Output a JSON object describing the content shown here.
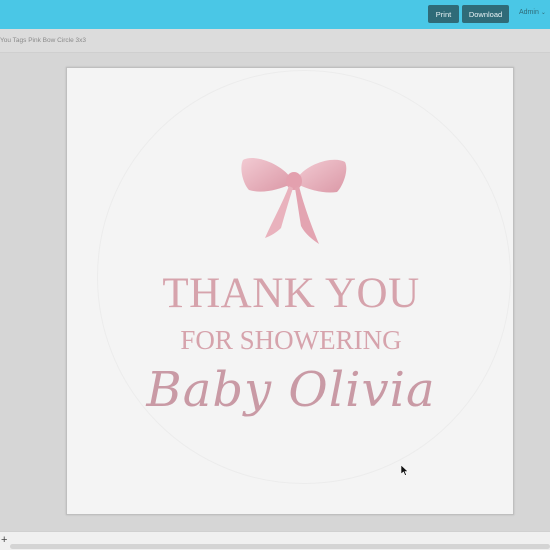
{
  "header": {
    "print_label": "Print",
    "download_label": "Download",
    "user_label": "Admin",
    "accent_color": "#4ac7e6",
    "button_color": "#2f6b78"
  },
  "document": {
    "title": "You Tags Pink Bow Circle 3x3"
  },
  "design": {
    "line1": "THANK YOU",
    "line2": "FOR SHOWERING",
    "line3": "Baby Olivia",
    "text_color": "#d6a3ac",
    "ornament": "pink-bow"
  },
  "bottom": {
    "add_label": "+"
  }
}
